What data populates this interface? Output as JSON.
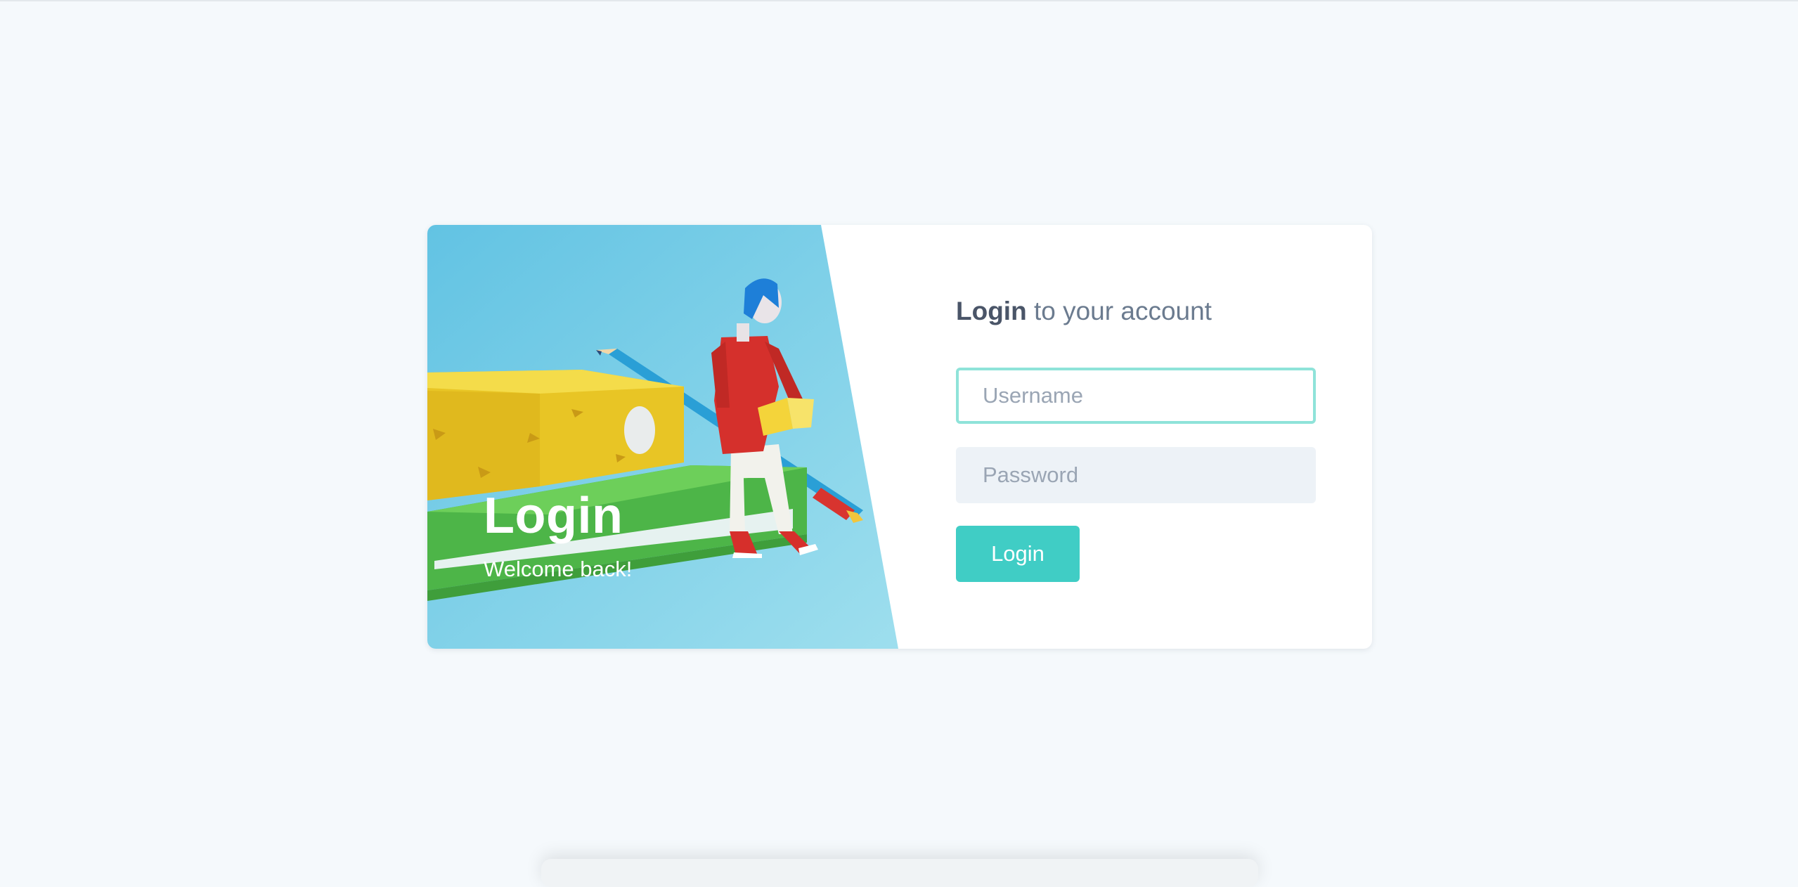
{
  "hero": {
    "title": "Login",
    "subtitle": "Welcome back!"
  },
  "form": {
    "heading_bold": "Login",
    "heading_rest": " to your account",
    "username_placeholder": "Username",
    "password_placeholder": "Password",
    "submit_label": "Login"
  },
  "colors": {
    "page_background": "#f5f9fc",
    "accent": "#40cdc5",
    "input_focus_border": "#8fe3d9",
    "input_fill": "#edf2f7",
    "heading_text": "#4a5568"
  }
}
